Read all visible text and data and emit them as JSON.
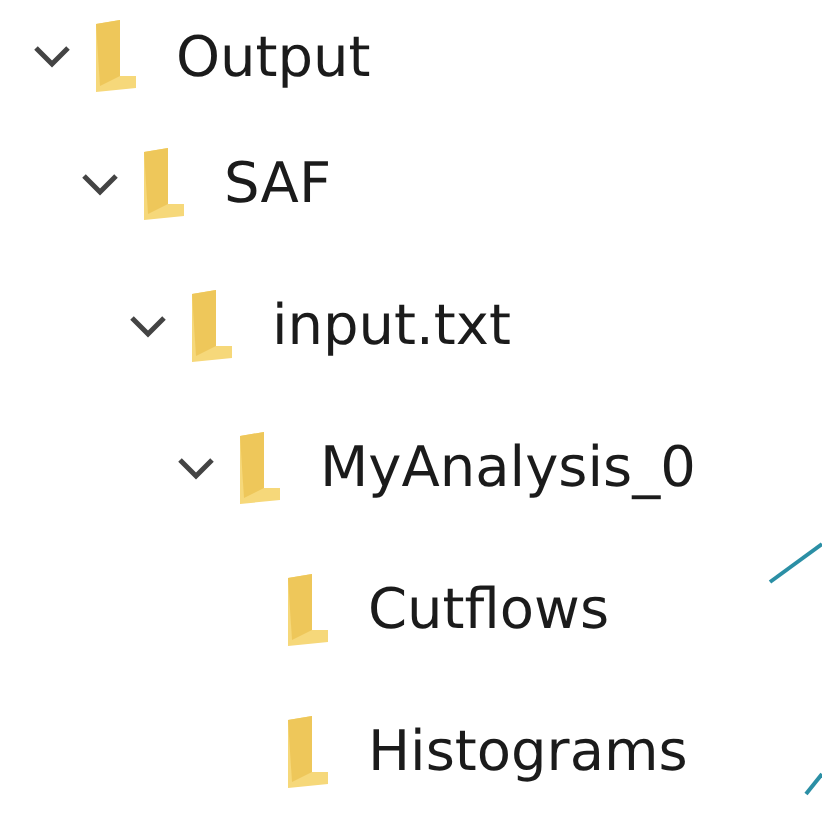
{
  "tree": [
    {
      "label": "Output",
      "expanded": true,
      "children": [
        {
          "label": "SAF",
          "expanded": true,
          "children": [
            {
              "label": "input.txt",
              "expanded": true,
              "children": [
                {
                  "label": "MyAnalysis_0",
                  "expanded": true,
                  "children": [
                    {
                      "label": "Cutflows"
                    },
                    {
                      "label": "Histograms"
                    }
                  ]
                }
              ]
            }
          ]
        }
      ]
    }
  ]
}
